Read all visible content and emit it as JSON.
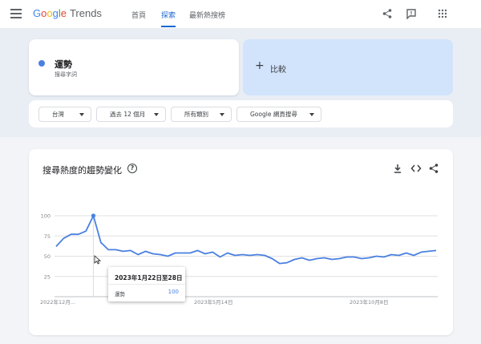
{
  "header": {
    "brand_google": [
      "G",
      "o",
      "o",
      "g",
      "l",
      "e"
    ],
    "brand_trends": "Trends",
    "tabs": [
      {
        "label": "首頁",
        "active": false
      },
      {
        "label": "探索",
        "active": true
      },
      {
        "label": "最新熱搜榜",
        "active": false
      }
    ],
    "icons": [
      "menu-icon",
      "share-icon",
      "feedback-icon",
      "apps-grid-icon"
    ]
  },
  "term": {
    "name": "運勢",
    "subtitle": "搜尋字詞",
    "color": "#4a80e0"
  },
  "compare": {
    "plus": "+",
    "label": "比較"
  },
  "filters": [
    {
      "label": "台灣"
    },
    {
      "label": "過去 12 個月"
    },
    {
      "label": "所有類別"
    },
    {
      "label": "Google 網頁搜尋"
    }
  ],
  "chart": {
    "title": "搜尋熱度的趨勢變化",
    "help_icon": "?",
    "icons": [
      "download-icon",
      "embed-icon",
      "share-icon"
    ]
  },
  "chart_data": {
    "type": "line",
    "title": "搜尋熱度的趨勢變化",
    "series": [
      {
        "name": "運勢",
        "color": "#4a80e0",
        "values": [
          62,
          72,
          77,
          77,
          81,
          100,
          67,
          58,
          58,
          56,
          57,
          52,
          56,
          53,
          52,
          50,
          54,
          54,
          54,
          57,
          53,
          55,
          49,
          54,
          51,
          52,
          51,
          52,
          51,
          47,
          41,
          42,
          46,
          48,
          45,
          47,
          48,
          46,
          47,
          49,
          49,
          47,
          48,
          50,
          49,
          52,
          51,
          54,
          51,
          55,
          56,
          57
        ]
      }
    ],
    "x_tick_labels": [
      "2022年12月...",
      "2023年5月14日",
      "2023年10月8日"
    ],
    "y_ticks": [
      25,
      50,
      75,
      100
    ],
    "ylim": [
      0,
      100
    ],
    "grid": true,
    "highlight_index": 5
  },
  "tooltip": {
    "date": "2023年1月22日至28日",
    "term": "運勢",
    "value": "100"
  }
}
